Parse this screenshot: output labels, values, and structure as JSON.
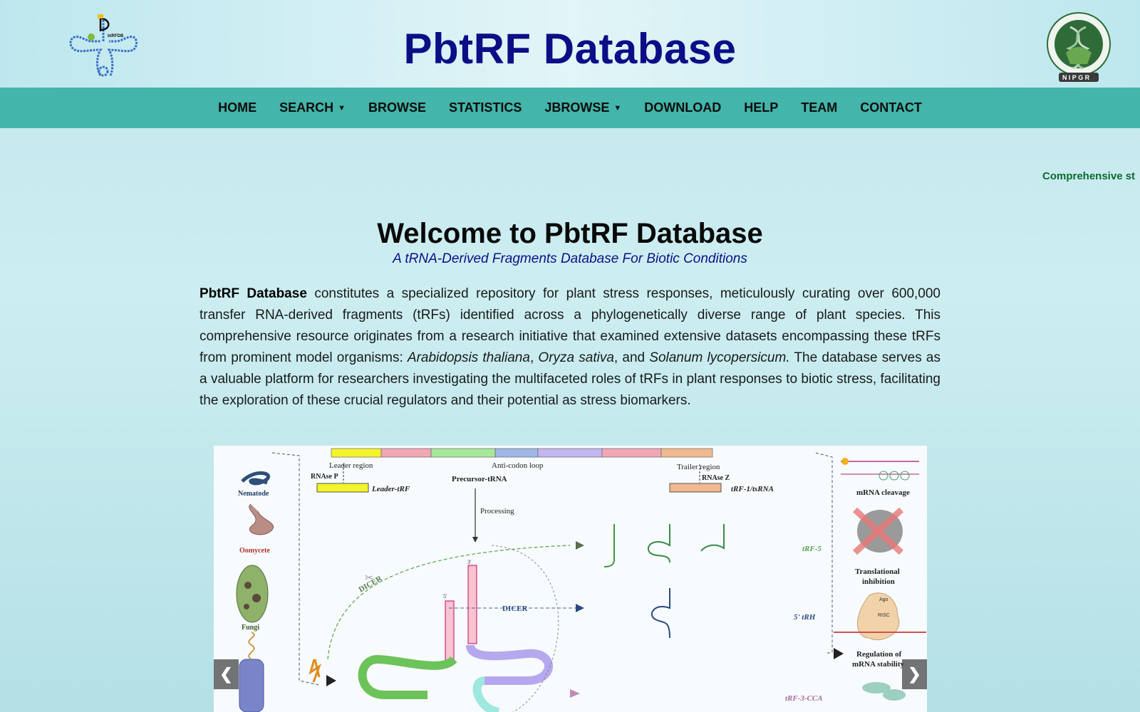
{
  "header": {
    "title": "PbtRF Database",
    "logo_left_text": "btRFDB",
    "logo_right_text": "NIPGR"
  },
  "nav": {
    "items": [
      {
        "label": "HOME",
        "dropdown": false
      },
      {
        "label": "SEARCH",
        "dropdown": true
      },
      {
        "label": "BROWSE",
        "dropdown": false
      },
      {
        "label": "STATISTICS",
        "dropdown": false
      },
      {
        "label": "JBROWSE",
        "dropdown": true
      },
      {
        "label": "DOWNLOAD",
        "dropdown": false
      },
      {
        "label": "HELP",
        "dropdown": false
      },
      {
        "label": "TEAM",
        "dropdown": false
      },
      {
        "label": "CONTACT",
        "dropdown": false
      }
    ],
    "caret": "▼"
  },
  "marquee": {
    "text": "Comprehensive st"
  },
  "main": {
    "welcome": "Welcome to PbtRF Database",
    "subtitle": "A tRNA-Derived Fragments Database For Biotic Conditions",
    "intro": {
      "bold": "PbtRF Database",
      "part1": " constitutes a specialized repository for plant stress responses, meticulously curating over 600,000 transfer RNA-derived fragments (tRFs) identified across a phylogenetically diverse range of plant species. This comprehensive resource originates from a research initiative that examined extensive datasets encompassing these tRFs from prominent model organisms: ",
      "species1": "Arabidopsis thaliana",
      "sep1": ", ",
      "species2": "Oryza sativa",
      "sep2": ", and ",
      "species3": "Solanum lycopersicum.",
      "part2": " The database serves as a valuable platform for researchers investigating the multifaceted roles of tRFs in plant responses to biotic stress, facilitating the exploration of these crucial regulators and their potential as stress biomarkers."
    }
  },
  "figure": {
    "pathogens": [
      "Nematode",
      "Oomycete",
      "Fungi"
    ],
    "labels": {
      "leader_region": "Leader region",
      "anticodon_loop": "Anti-codon loop",
      "trailer_region": "Trailer region",
      "rnase_p": "RNAse P",
      "rnase_z": "RNAse Z",
      "precursor": "Precursor-tRNA",
      "leader_trf": "Leader-tRF",
      "trf1": "tRF-1/tsRNA",
      "processing": "Processing",
      "dicer1": "DICER",
      "dicer2": "DICER",
      "trf5": "tRF-5",
      "trh5": "5' tRH",
      "trf3cca": "tRF-3-CCA",
      "mrna_cleavage": "mRNA cleavage",
      "translational1": "Translational",
      "translational2": "inhibition",
      "regulation1": "Regulation of",
      "regulation2": "mRNA stability",
      "ago": "Ago",
      "risc": "RISC",
      "prime5": "5'",
      "prime3": "3'"
    }
  },
  "slider": {
    "prev": "❮",
    "next": "❯"
  },
  "colors": {
    "title": "#0b0f86",
    "navbar": "#43b5ab",
    "marquee": "#0b6b2f"
  }
}
